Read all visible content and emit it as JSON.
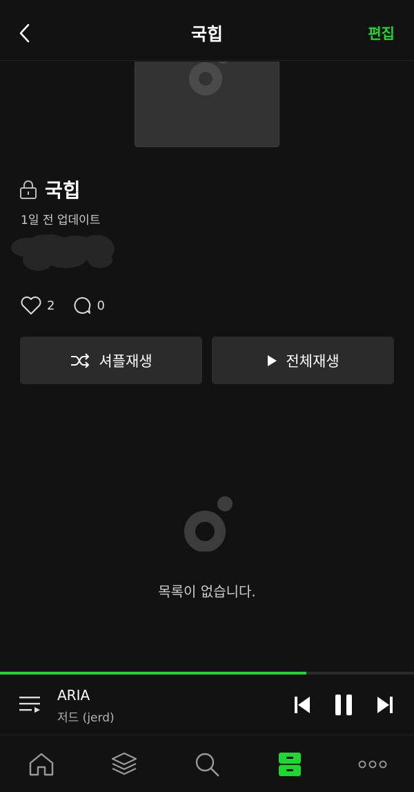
{
  "colors": {
    "background": "#121212",
    "accent": "#1ed731",
    "card": "#2b2b2b",
    "muted_text": "#cccccc"
  },
  "header": {
    "title": "국힙",
    "edit_label": "편집",
    "back_icon": "chevron-left-icon"
  },
  "playlist": {
    "title": "국힙",
    "lock_icon": "lock-icon",
    "updated": "1일 전 업데이트",
    "likes": "2",
    "comments": "0"
  },
  "actions": {
    "shuffle_label": "셔플재생",
    "play_all_label": "전체재생"
  },
  "empty_state": {
    "message": "목록이 없습니다."
  },
  "now_playing": {
    "title": "ARIA",
    "artist": "저드 (jerd)",
    "progress": 0.74
  },
  "bottom_nav": {
    "items": [
      "home-icon",
      "layers-icon",
      "search-icon",
      "library-icon",
      "more-icon"
    ],
    "active": "library-icon"
  }
}
